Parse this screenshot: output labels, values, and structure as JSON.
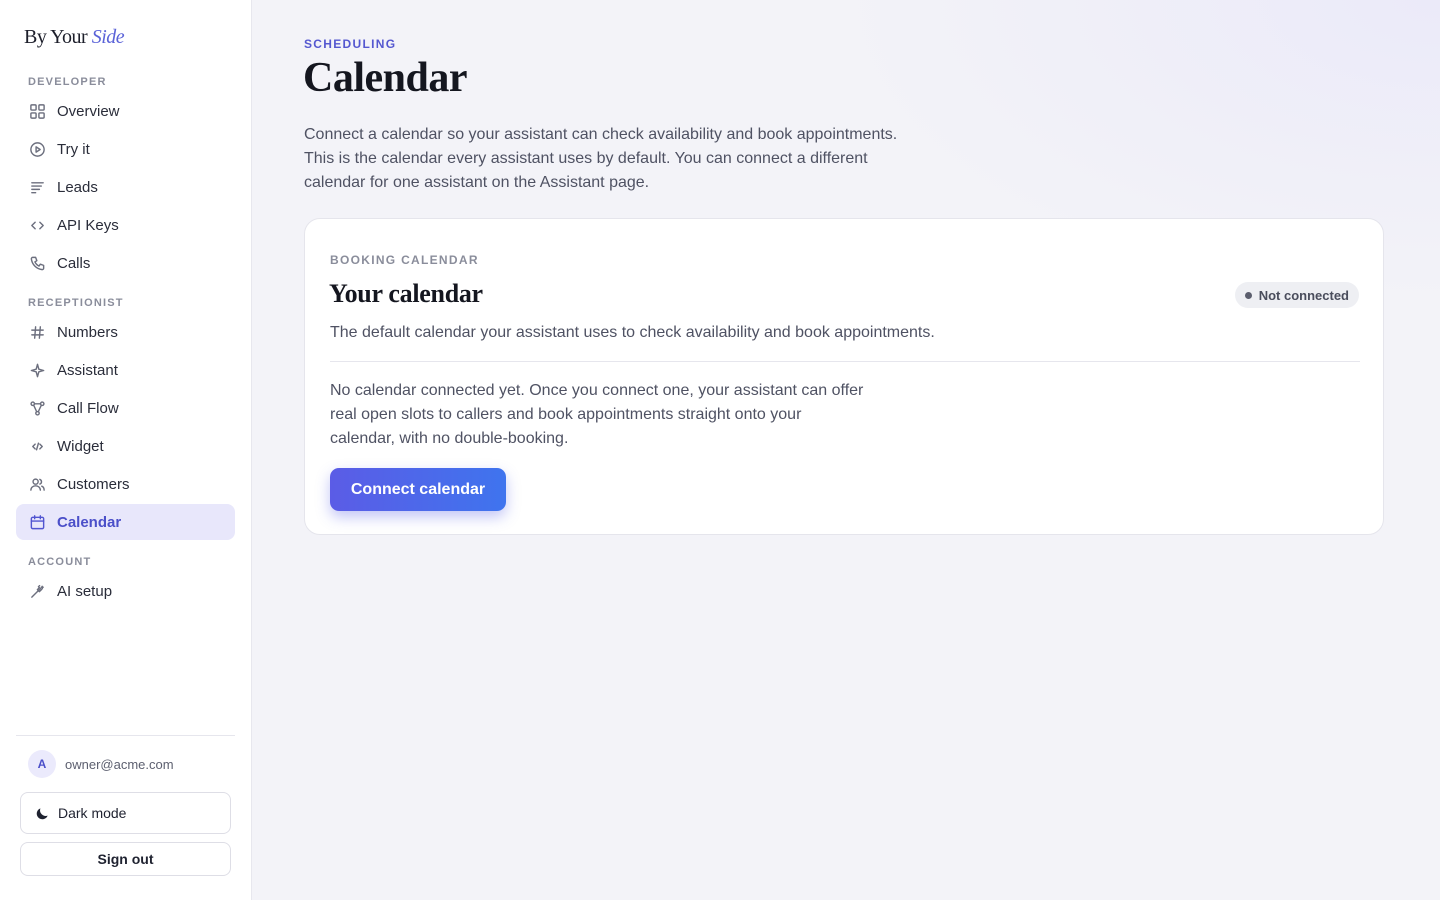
{
  "brand": {
    "name_plain": "By Your",
    "name_accent": "Side"
  },
  "sidebar": {
    "sections": [
      {
        "label": "DEVELOPER"
      },
      {
        "label": "RECEPTIONIST"
      },
      {
        "label": "ACCOUNT"
      }
    ],
    "items": [
      {
        "label": "Overview",
        "icon": "grid-icon"
      },
      {
        "label": "Try it",
        "icon": "play-circle-icon"
      },
      {
        "label": "Leads",
        "icon": "lines-icon"
      },
      {
        "label": "API Keys",
        "icon": "code-icon"
      },
      {
        "label": "Calls",
        "icon": "phone-icon"
      },
      {
        "label": "Numbers",
        "icon": "hash-icon"
      },
      {
        "label": "Assistant",
        "icon": "sparkle-icon"
      },
      {
        "label": "Call Flow",
        "icon": "flow-icon"
      },
      {
        "label": "Widget",
        "icon": "code-small-icon"
      },
      {
        "label": "Customers",
        "icon": "users-icon"
      },
      {
        "label": "Calendar",
        "icon": "calendar-icon",
        "active": true
      },
      {
        "label": "AI setup",
        "icon": "wand-icon"
      }
    ],
    "user": {
      "avatar_initial": "A",
      "email": "owner@acme.com"
    },
    "dark_mode_label": "Dark mode",
    "sign_out_label": "Sign out"
  },
  "main": {
    "eyebrow": "SCHEDULING",
    "title": "Calendar",
    "description": "Connect a calendar so your assistant can check availability and book appointments. This is the calendar every assistant uses by default. You can connect a different calendar for one assistant on the Assistant page.",
    "card": {
      "eyebrow": "BOOKING CALENDAR",
      "title": "Your calendar",
      "status": "Not connected",
      "subtitle": "The default calendar your assistant uses to check availability and book appointments.",
      "body": "No calendar connected yet. Once you connect one, your assistant can offer real open slots to callers and book appointments straight onto your calendar, with no double-booking.",
      "button_label": "Connect calendar"
    }
  },
  "colors": {
    "accent": "#5558d0",
    "active_bg": "#e8e7fb",
    "button_start": "#5b5ce6",
    "button_end": "#3f74ee"
  }
}
